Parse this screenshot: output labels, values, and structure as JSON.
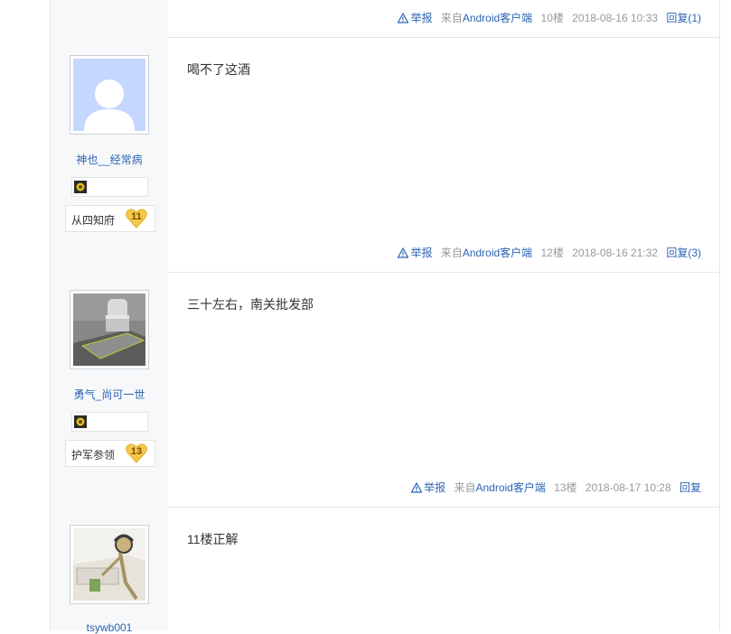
{
  "posts": [
    {
      "tail": {
        "report": "举报",
        "source_prefix": "来自",
        "source_client": "Android客户端",
        "floor": "10楼",
        "time": "2018-08-16 10:33",
        "reply": "回复(1)"
      }
    },
    {
      "username": "神也__经常病",
      "level_name": "从四知府",
      "level": "11",
      "content": "喝不了这酒",
      "tail": {
        "report": "举报",
        "source_prefix": "来自",
        "source_client": "Android客户端",
        "floor": "12楼",
        "time": "2018-08-16 21:32",
        "reply": "回复(3)"
      }
    },
    {
      "username": "勇气_尚可一世",
      "level_name": "护军参领",
      "level": "13",
      "content": "三十左右，南关批发部",
      "tail": {
        "report": "举报",
        "source_prefix": "来自",
        "source_client": "Android客户端",
        "floor": "13楼",
        "time": "2018-08-17 10:28",
        "reply": "回复"
      }
    },
    {
      "username": "tsywb001",
      "content": "11楼正解"
    }
  ],
  "colors": {
    "link": "#2d64b3",
    "muted": "#999999",
    "sidebar_bg": "#f7f8fa",
    "border": "#e4e6eb",
    "level_badge": "#f5c84a"
  }
}
